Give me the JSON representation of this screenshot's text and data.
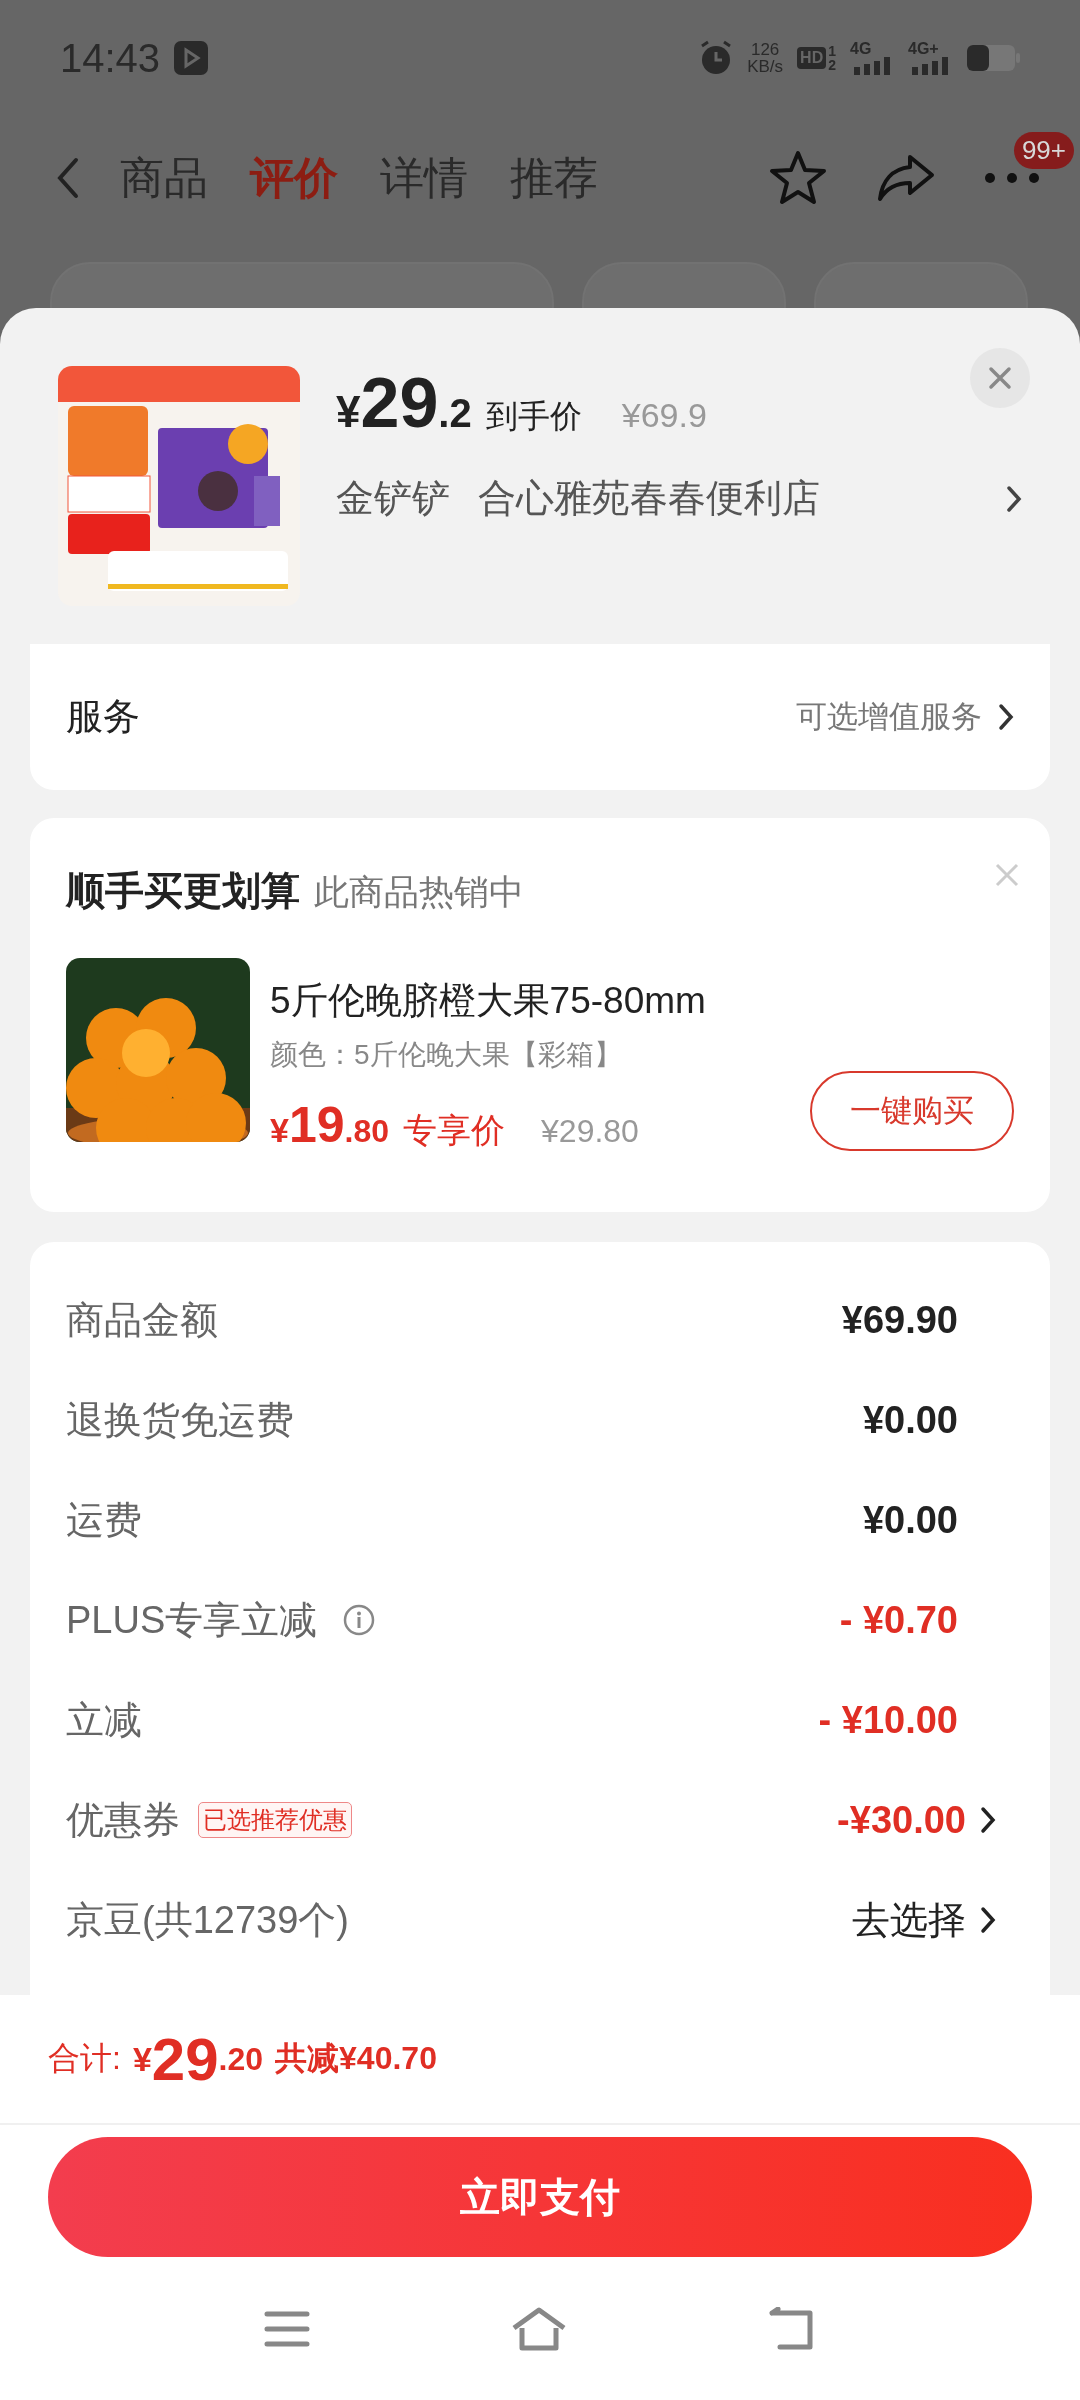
{
  "status_bar": {
    "time": "14:43",
    "net_speed": "126",
    "net_unit": "KB/s",
    "hd": "HD",
    "hd_sup": "1",
    "hd_sub": "2",
    "sim1": "4G",
    "sim2": "4G+"
  },
  "nav": {
    "tabs": [
      {
        "label": "商品",
        "selected": false
      },
      {
        "label": "评价",
        "selected": true
      },
      {
        "label": "详情",
        "selected": false
      },
      {
        "label": "推荐",
        "selected": false
      }
    ],
    "badge": "99+"
  },
  "product": {
    "currency": "¥",
    "price_int": "29",
    "price_dec": ".2",
    "price_label": "到手价",
    "original_price": "¥69.9",
    "variant": "金铲铲",
    "store": "合心雅苑春春便利店"
  },
  "services": {
    "label": "服务",
    "hint": "可选增值服务"
  },
  "addon": {
    "title": "顺手买更划算",
    "subtitle": "此商品热销中",
    "item": {
      "name": "5斤伦晚脐橙大果75-80mm",
      "spec": "颜色：5斤伦晚大果【彩箱】",
      "currency": "¥",
      "price_int": "19",
      "price_dec": ".80",
      "price_label": "专享价",
      "original_price": "¥29.80",
      "buy": "一键购买"
    }
  },
  "summary": {
    "rows": [
      {
        "label": "商品金额",
        "value": "¥69.90",
        "kind": "normal",
        "info": false,
        "chevron": false
      },
      {
        "label": "退换货免运费",
        "value": "¥0.00",
        "kind": "normal",
        "info": false,
        "chevron": false
      },
      {
        "label": "运费",
        "value": "¥0.00",
        "kind": "normal",
        "info": false,
        "chevron": false
      },
      {
        "label": "PLUS专享立减",
        "value": "- ¥0.70",
        "kind": "discount",
        "info": true,
        "chevron": false
      },
      {
        "label": "立减",
        "value": "- ¥10.00",
        "kind": "discount",
        "info": false,
        "chevron": false
      },
      {
        "label": "优惠券",
        "tag": "已选推荐优惠",
        "value": "-¥30.00",
        "kind": "discount",
        "info": false,
        "chevron": true
      },
      {
        "label": "京豆(共12739个)",
        "value": "去选择",
        "kind": "normal",
        "info": false,
        "chevron": true
      }
    ]
  },
  "footer": {
    "total_label": "合计:",
    "currency": "¥",
    "total_int": "29",
    "total_dec": ".20",
    "saved": "共减¥40.70",
    "pay": "立即支付"
  }
}
